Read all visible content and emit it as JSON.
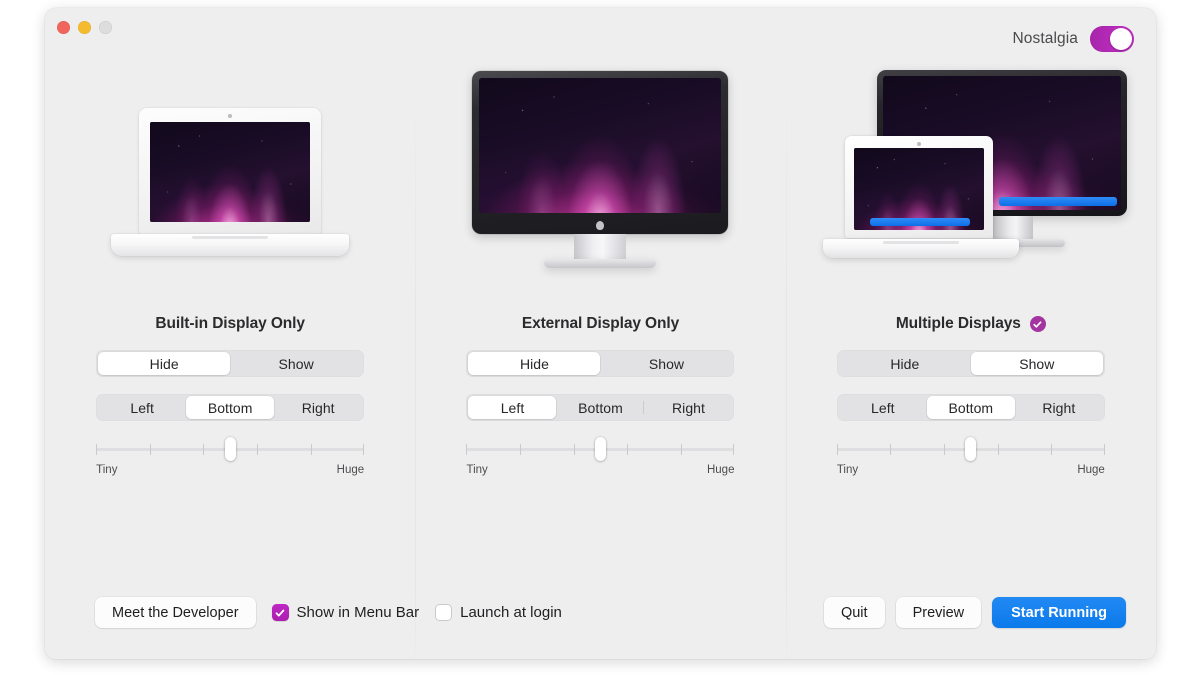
{
  "window": {
    "traffic_lights": [
      "close",
      "minimize",
      "zoom"
    ],
    "accent_purple": "#b52ab8",
    "accent_blue": "#0b7aeb"
  },
  "header": {
    "nostalgia_label": "Nostalgia",
    "nostalgia_toggle_state": "on"
  },
  "columns": [
    {
      "title": "Built-in Display Only",
      "has_active_badge": false,
      "visibility": {
        "options": [
          "Hide",
          "Show"
        ],
        "selected": "Hide"
      },
      "position": {
        "options": [
          "Left",
          "Bottom",
          "Right"
        ],
        "selected": "Bottom"
      },
      "size_slider": {
        "min_label": "Tiny",
        "max_label": "Huge",
        "ticks": 6,
        "value_percent": 50
      },
      "artwork": "white-macbook-aurora-wallpaper"
    },
    {
      "title": "External Display Only",
      "has_active_badge": false,
      "visibility": {
        "options": [
          "Hide",
          "Show"
        ],
        "selected": "Hide"
      },
      "position": {
        "options": [
          "Left",
          "Bottom",
          "Right"
        ],
        "selected": "Left"
      },
      "size_slider": {
        "min_label": "Tiny",
        "max_label": "Huge",
        "ticks": 6,
        "value_percent": 50
      },
      "artwork": "cinema-display-aurora-wallpaper"
    },
    {
      "title": "Multiple Displays",
      "has_active_badge": true,
      "visibility": {
        "options": [
          "Hide",
          "Show"
        ],
        "selected": "Show"
      },
      "position": {
        "options": [
          "Left",
          "Bottom",
          "Right"
        ],
        "selected": "Bottom"
      },
      "size_slider": {
        "min_label": "Tiny",
        "max_label": "Huge",
        "ticks": 6,
        "value_percent": 50
      },
      "artwork": "laptop-plus-display-aurora-wallpaper-with-dock"
    }
  ],
  "footer": {
    "meet_developer_label": "Meet the Developer",
    "show_in_menu_bar": {
      "label": "Show in Menu Bar",
      "checked": true
    },
    "launch_at_login": {
      "label": "Launch at login",
      "checked": false
    },
    "quit_label": "Quit",
    "preview_label": "Preview",
    "start_running_label": "Start Running"
  }
}
